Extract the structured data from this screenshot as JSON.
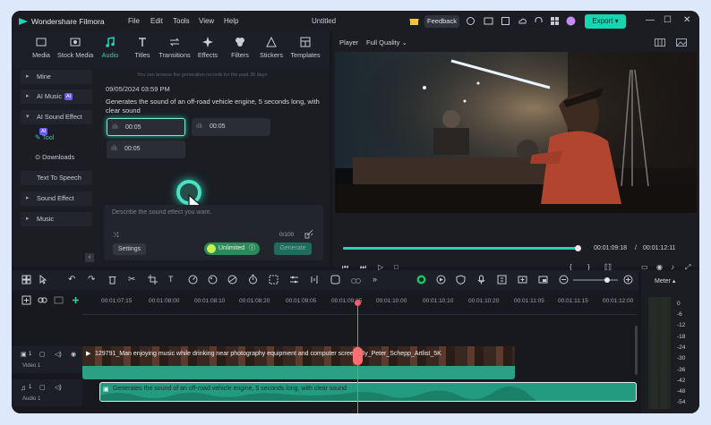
{
  "titlebar": {
    "app_name": "Wondershare Filmora",
    "menus": [
      "File",
      "Edit",
      "Tools",
      "View",
      "Help"
    ],
    "document": "Untitled",
    "feedback": "Feedback",
    "export": "Export"
  },
  "toolbox": {
    "tools": [
      "Media",
      "Stock Media",
      "Audio",
      "Titles",
      "Transitions",
      "Effects",
      "Filters",
      "Stickers",
      "Templates"
    ],
    "active": "Audio"
  },
  "sidebar": {
    "items": [
      "Mine",
      "AI Music",
      "AI Sound Effect",
      "Tool",
      "Downloads",
      "Text To Speech",
      "Sound Effect",
      "Music"
    ],
    "ai_badge": "AI"
  },
  "generator": {
    "hint": "You can browse the generation records for the past 30 days",
    "date": "09/05/2024 03:59 PM",
    "description": "Generates the sound of an off-road vehicle engine, 5 seconds long, with clear sound",
    "clips": [
      "00:05",
      "00:05",
      "00:05"
    ],
    "placeholder": "Describe the sound effect you want.",
    "counter": "0/100",
    "settings": "Settings",
    "unlimited": "Unlimited",
    "generate": "Generate"
  },
  "player": {
    "label": "Player",
    "quality": "Full Quality",
    "progress": 0.99,
    "current_time": "00:01:09:18",
    "separator": "/",
    "total_time": "00:01:12:11"
  },
  "timeline": {
    "ruler": [
      "00:01:07:15",
      "00:01:08:00",
      "00:01:08:10",
      "00:01:08:20",
      "00:01:09:05",
      "00:01:09:15",
      "00:01:10:00",
      "00:01:10:10",
      "00:01:10:20",
      "00:01:11:05",
      "00:01:11:15",
      "00:01:12:00"
    ],
    "video_track": "Video 1",
    "audio_track": "Audio 1",
    "track_num": "1",
    "video_clip": "129791_Man enjoying music while drinking near photography equipment and computer screen_By_Peter_Schepp_Artlist_5K",
    "audio_clip": "Generates the sound of an off-road vehicle engine, 5 seconds long, with clear sound"
  },
  "meter": {
    "title": "Meter",
    "scale": [
      "0",
      "-6",
      "-12",
      "-18",
      "-24",
      "-30",
      "-36",
      "-42",
      "-48",
      "-54"
    ]
  },
  "colors": {
    "accent": "#21d6b8",
    "playhead": "#ff5a6a",
    "background": "#16181d"
  }
}
